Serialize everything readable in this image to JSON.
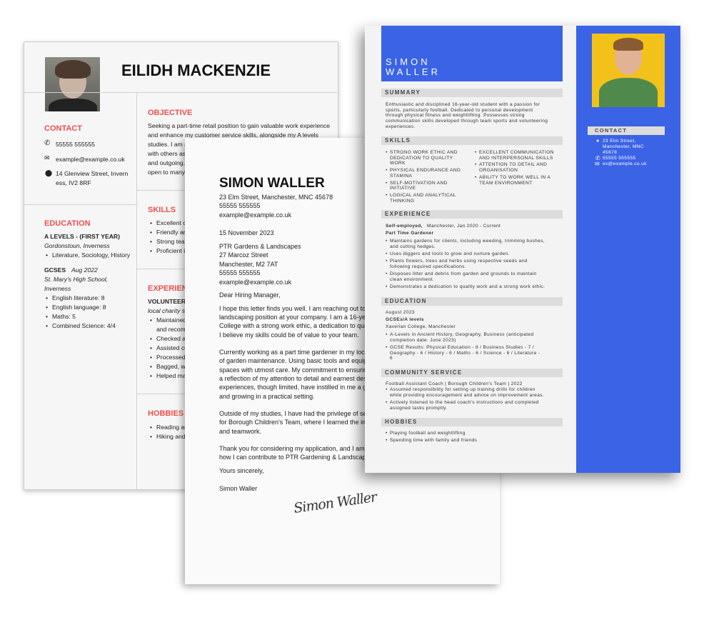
{
  "resume_eilidh": {
    "name": "EILIDH MACKENZIE",
    "contact": {
      "heading": "CONTACT",
      "phone": "55555 555555",
      "email": "example@example.co.uk",
      "address_l1": "14 Glenview Street, Invern",
      "address_l2": "ess, IV2 8RF"
    },
    "education": {
      "heading": "EDUCATION",
      "alevels": {
        "title": "A LEVELS - (FIRST YEAR)",
        "school": "Gordonstoun, Inverness",
        "subjects": "Literature, Sociology, History"
      },
      "gcses": {
        "title": "GCSES",
        "date": "Aug 2022",
        "school_l1": "St. Mary's High School,",
        "school_l2": "Inverness",
        "grades": [
          "English literature: 8",
          "English language: 8",
          "Maths: 5",
          "Combined Science: 4/4"
        ]
      }
    },
    "objective": {
      "heading": "OBJECTIVE",
      "lines": [
        "Seeking a part-time retail position to gain valuable work experience",
        "and enhance my customer service skills, alongside my A levels",
        "studies. I am a",
        "with others as",
        "and outgoing.",
        "open to many"
      ]
    },
    "skills": {
      "heading": "SKILLS",
      "items": [
        "Excellent co",
        "Friendly and",
        "Strong team",
        "Proficient in"
      ]
    },
    "experience": {
      "heading": "EXPERIENCE",
      "role": "VOLUNTEER",
      "org": "local charity sh",
      "bullets": [
        "Maintained",
        "and recomm",
        "Checked ar",
        "Assisted cu",
        "Processed",
        "Bagged, wr",
        "Helped mai"
      ]
    },
    "hobbies": {
      "heading": "HOBBIES A",
      "items": [
        "Reading an",
        "Hiking and"
      ]
    }
  },
  "cover_letter": {
    "name": "SIMON WALLER",
    "sender": [
      "23 Elm Street, Manchester, MNC 45678",
      "55555 555555",
      "example@example.co.uk"
    ],
    "date": "15 November 2023",
    "recipient": [
      "PTR Gardens & Landscapes",
      "27 Marcoz Street",
      "Manchester, M2 7AT",
      "55555 555555",
      "example@example.co.uk"
    ],
    "greeting": "Dear Hiring Manager,",
    "para1": [
      "I hope this letter finds you well. I am reaching out to e",
      "landscaping position at your company. I am a 16-year",
      "College with a strong work ethic, a dedication to quali",
      "I believe my skills could be of value to your team."
    ],
    "para2": [
      "Currently working as a part time gardener in my local",
      "of garden maintenance. Using basic tools and equipm",
      "spaces with utmost care. My commitment to ensuring",
      "a reflection of my attention to detail and earnest desi",
      "experiences, though limited, have instilled in me a ge",
      "and growing in a practical setting."
    ],
    "para3": [
      "Outside of my studies, I have had the privilege of serv",
      "for Borough Children's Team, where I learned the imp",
      "and teamwork."
    ],
    "para4": [
      "Thank you for considering my application, and I am ho",
      "how I can contribute to PTR Gardening & Landscapin"
    ],
    "closing": "Yours sincerely,",
    "signoff": "Simon Waller",
    "signature": "Simon Waller"
  },
  "resume_simon": {
    "accent": "#3b63e6",
    "name_first": "SIMON",
    "name_last": "WALLER",
    "summary": {
      "heading": "SUMMARY",
      "lines": [
        "Enthusiastic and disciplined 16-year-old student with a passion for",
        "sports, particularly football. Dedicated to personal development",
        "through physical fitness and weightlifting. Possesses strong",
        "communication skills developed through team sports and volunteering",
        "experiences."
      ]
    },
    "skills": {
      "heading": "SKILLS",
      "left": [
        [
          "STRONG WORK ETHIC AND",
          "DEDICATION TO QUALITY",
          "WORK"
        ],
        [
          "PHYSICAL ENDURANCE AND",
          "STAMINA"
        ],
        [
          "SELF-MOTIVATION AND",
          "INITIATIVE"
        ],
        [
          "LOGICAL AND ANALYTICAL",
          "THINKING"
        ]
      ],
      "right": [
        [
          "EXCELLENT COMMUNICATION",
          "AND INTERPERSONAL SKILLS"
        ],
        [
          "ATTENTION TO DETAIL AND",
          "ORGANISATION"
        ],
        [
          "ABILITY TO WORK WELL IN A",
          "TEAM ENVIRONMENT"
        ]
      ]
    },
    "experience": {
      "heading": "EXPERIENCE",
      "employer": "Self-employed,",
      "meta": "Manchester, Jan 2020 - Current",
      "role": "Part Time Gardener",
      "bullets": [
        [
          "Maintains gardens for clients, including weeding, trimming bushes,",
          "and cutting hedges."
        ],
        [
          "Uses diggers and tools to grow and nurture garden."
        ],
        [
          "Plants flowers, trees and herbs using respective seeds and",
          "following required specifications."
        ],
        [
          "Disposes litter and debris from garden and grounds to maintain",
          "clean environment."
        ],
        [
          "Demonstrates a dedication to quality work and a strong work ethic."
        ]
      ]
    },
    "education": {
      "heading": "EDUCATION",
      "date": "August 2023",
      "title": "GCSEs/A levels",
      "school": "Xaverian College, Manchester",
      "bullets": [
        [
          "A-Levels in Ancient History, Geography, Business (anticipated",
          "completion date: June 2023)"
        ],
        [
          "GCSE Results: Physical Education - 8 / Business Studies - 7 /",
          "Geography - 6 / History - 6 /  Maths - 6 / Science - 6 / Literature -",
          "6"
        ]
      ]
    },
    "community": {
      "heading": "COMMUNITY SERVICE",
      "title": "Football Assistant Coach | Borough Children's Team | 2022",
      "bullets": [
        [
          "Assumed responsibility for setting up training drills for children",
          "while providing encouragement and advice on improvement areas."
        ],
        [
          "Actively listened to the head coach's instructions and completed",
          "assigned tasks promptly."
        ]
      ]
    },
    "hobbies": {
      "heading": "HOBBIES",
      "items": [
        "Playing football and weightlifting",
        "Spending time with family and friends"
      ]
    },
    "contact": {
      "heading": "CONTACT",
      "address": [
        "23 Elm Street,",
        "Manchester, MNC",
        "45678"
      ],
      "phone": "55555 555555",
      "email": "ex@example.co.uk"
    }
  }
}
